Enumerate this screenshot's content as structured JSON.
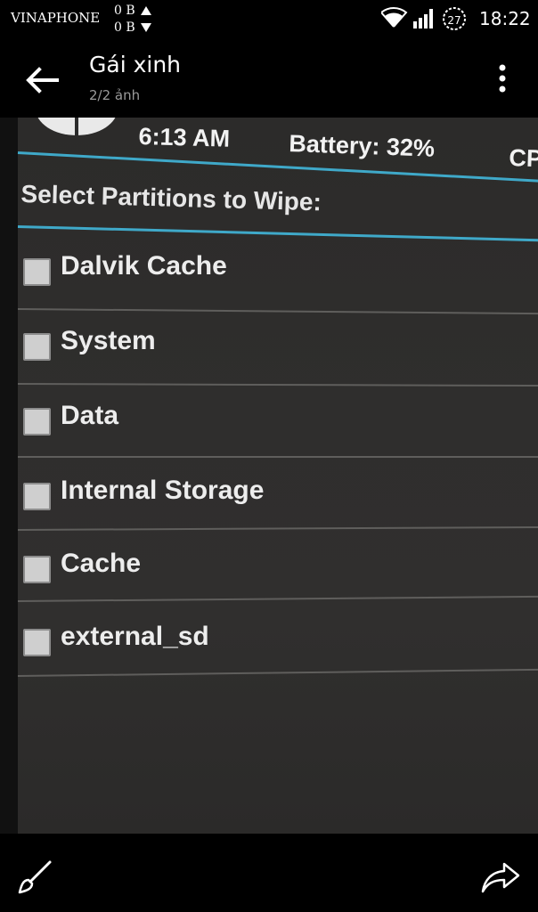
{
  "status_bar": {
    "carrier": "VINAPHONE",
    "upload": "0 B",
    "download": "0 B",
    "battery_level": "27",
    "time": "18:22"
  },
  "app_bar": {
    "title": "Gái xinh",
    "subtitle": "2/2 ảnh"
  },
  "photo": {
    "header": {
      "time": "6:13 AM",
      "battery": "Battery: 32%",
      "cpu": "CP"
    },
    "select_label": "Select Partitions to Wipe:",
    "partitions": [
      {
        "label": "Dalvik Cache",
        "checked": false
      },
      {
        "label": "System",
        "checked": false
      },
      {
        "label": "Data",
        "checked": false
      },
      {
        "label": "Internal Storage",
        "checked": false
      },
      {
        "label": "Cache",
        "checked": false
      },
      {
        "label": "external_sd",
        "checked": false
      }
    ],
    "accent_color": "#3fa9c9"
  },
  "icons": {
    "back": "arrow-left-icon",
    "more": "more-vert-icon",
    "edit": "brush-icon",
    "share": "share-icon",
    "wifi": "wifi-icon",
    "signal": "signal-icon",
    "battery": "battery-icon"
  }
}
